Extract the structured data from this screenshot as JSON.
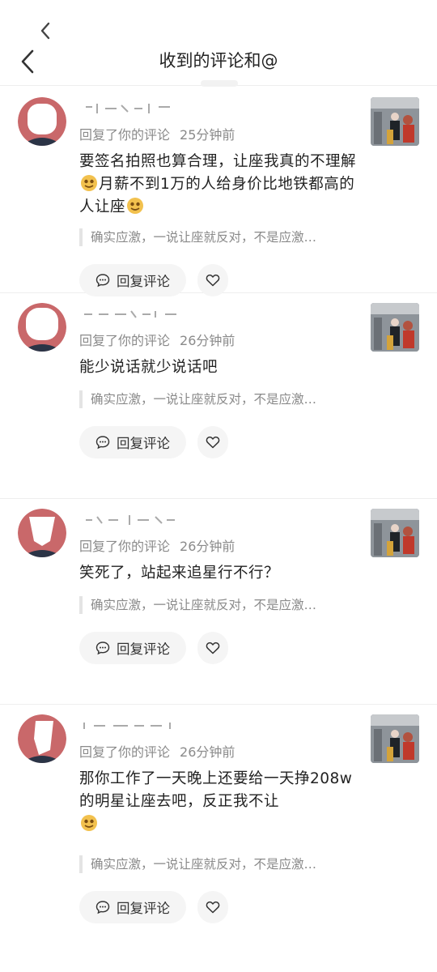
{
  "header": {
    "title": "收到的评论和@"
  },
  "comments": [
    {
      "username": "",
      "action": "回复了你的评论",
      "time": "25分钟前",
      "text_parts": [
        "要签名拍照也算合理，让座我真的不理解",
        "月薪不到1万的人给身价比地铁都高的人让座",
        ""
      ],
      "quote": "确实应激，一说让座就反对，不是应激…",
      "reply_label": "回复评论"
    },
    {
      "username": "",
      "action": "回复了你的评论",
      "time": "26分钟前",
      "text_parts": [
        "能少说话就少说话吧"
      ],
      "quote": "确实应激，一说让座就反对，不是应激…",
      "reply_label": "回复评论"
    },
    {
      "username": "",
      "action": "回复了你的评论",
      "time": "26分钟前",
      "text_parts": [
        "笑死了，站起来追星行不行？"
      ],
      "quote": "确实应激，一说让座就反对，不是应激…",
      "reply_label": "回复评论"
    },
    {
      "username": "",
      "action": "回复了你的评论",
      "time": "26分钟前",
      "text_parts": [
        "那你工作了一天晚上还要给一天挣208w的明星让座去吧，反正我不让",
        ""
      ],
      "quote": "确实应激，一说让座就反对，不是应激…",
      "reply_label": "回复评论"
    }
  ],
  "icons": {
    "back": "chevron-left-icon",
    "emoji": "money-face-emoji-icon",
    "reply": "speech-bubble-icon",
    "like": "heart-icon"
  },
  "colors": {
    "accent_avatar_bg": "#c9686a",
    "muted_text": "#8a8a8a",
    "button_bg": "#f5f5f5"
  }
}
